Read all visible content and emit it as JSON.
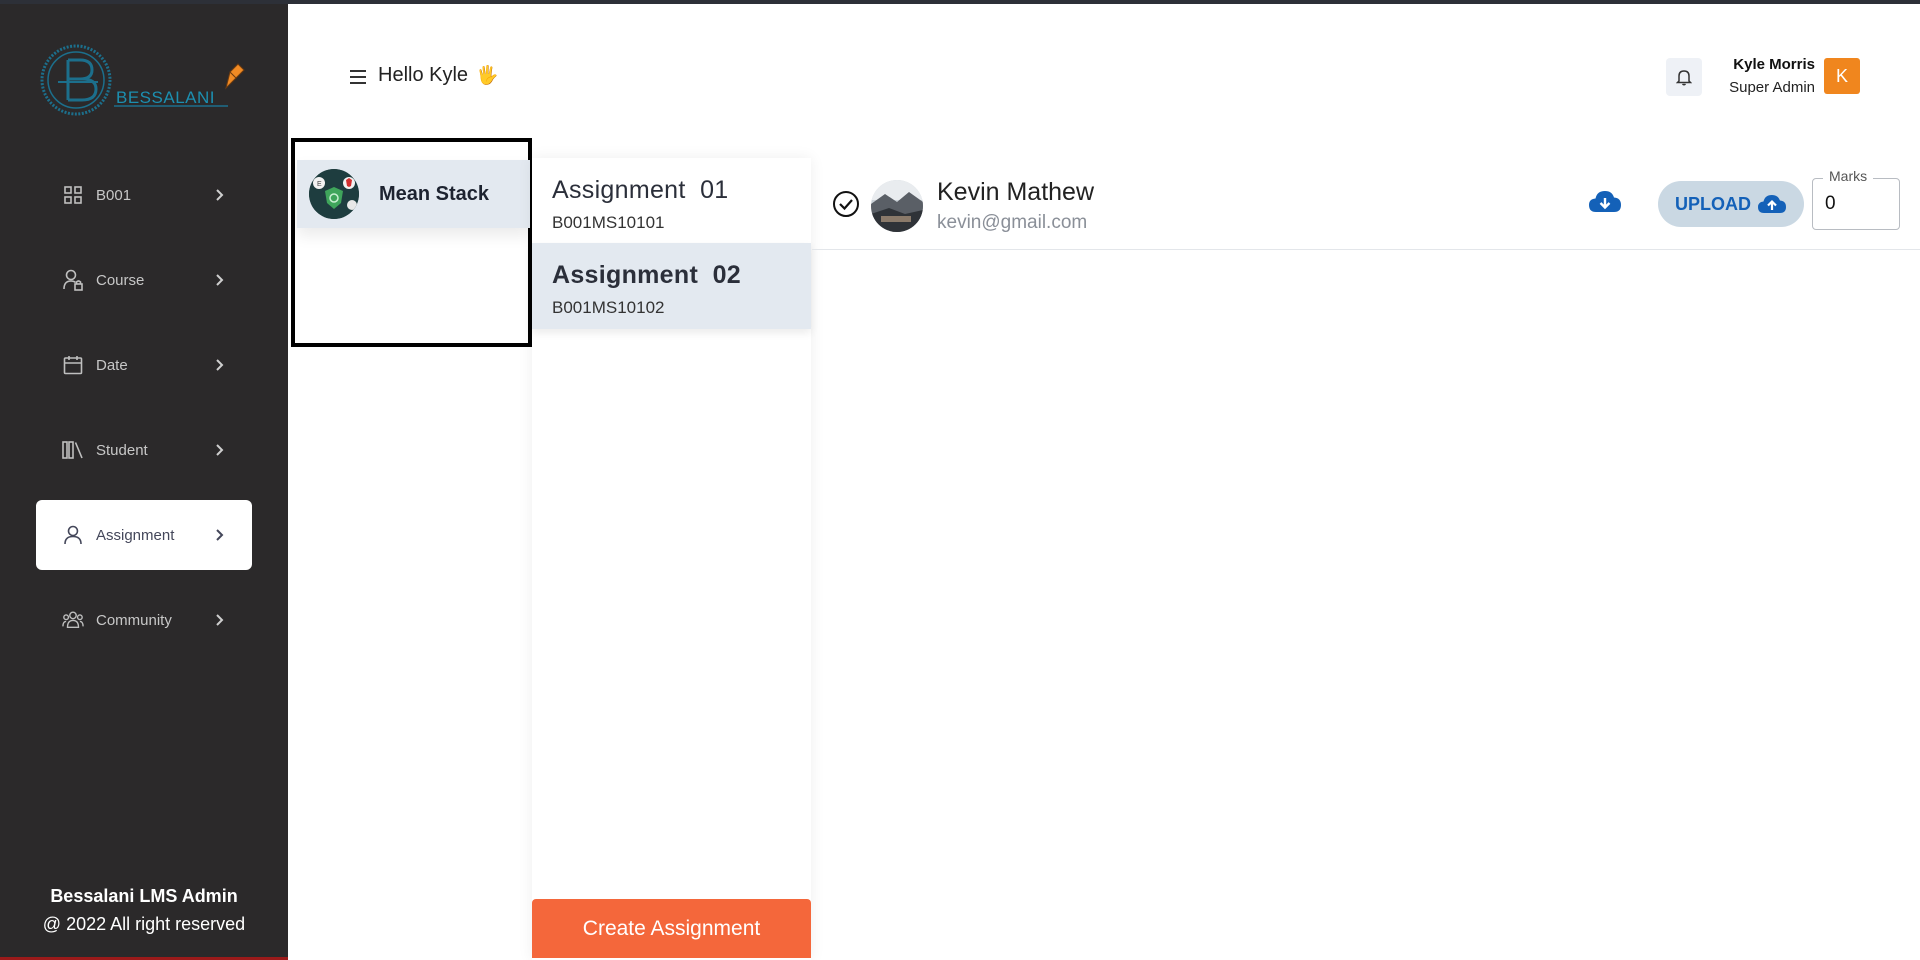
{
  "header": {
    "greeting": "Hello Kyle",
    "wave_emoji": "🖐",
    "user": {
      "name": "Kyle Morris",
      "role": "Super Admin",
      "avatar_letter": "K"
    }
  },
  "sidebar": {
    "logo_text": "BESSALANI",
    "items": [
      {
        "label": "B001",
        "icon": "grid-icon"
      },
      {
        "label": "Course",
        "icon": "user-lock-icon"
      },
      {
        "label": "Date",
        "icon": "calendar-icon"
      },
      {
        "label": "Student",
        "icon": "library-icon"
      },
      {
        "label": "Assignment",
        "icon": "user-icon",
        "active": true
      },
      {
        "label": "Community",
        "icon": "users-icon"
      }
    ],
    "footer": {
      "brand": "Bessalani LMS Admin",
      "copyright": "@ 2022 All right reserved"
    }
  },
  "courses": [
    {
      "label": "Mean Stack",
      "selected": true
    }
  ],
  "assignments": [
    {
      "title": "Assignment  01",
      "code": "B001MS10101"
    },
    {
      "title": "Assignment  02",
      "code": "B001MS10102",
      "selected": true
    }
  ],
  "create_button": "Create Assignment",
  "submission": {
    "student_name": "Kevin Mathew",
    "student_email": "kevin@gmail.com",
    "upload_label": "UPLOAD",
    "marks_label": "Marks",
    "marks_value": "0"
  },
  "colors": {
    "sidebar_bg": "#2b292a",
    "accent_orange": "#f4673b",
    "avatar_orange": "#f0861e",
    "upload_blue": "#1461b8",
    "selected_bg": "#e3e9f0"
  }
}
